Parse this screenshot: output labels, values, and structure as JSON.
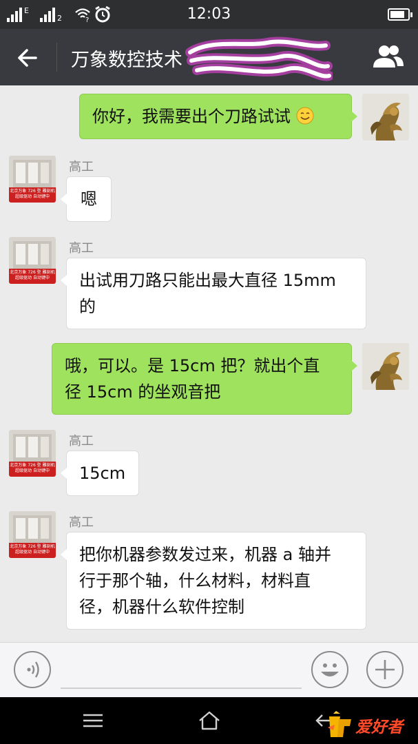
{
  "status_bar": {
    "time": "12:03",
    "network_tags": [
      "E",
      "2"
    ],
    "battery_level": 0.85
  },
  "header": {
    "title": "万象数控技术"
  },
  "messages": [
    {
      "direction": "outgoing",
      "lines": [
        "你好，我需要出个刀路试试"
      ],
      "emoji": "smile-emoji"
    },
    {
      "direction": "incoming",
      "sender": "高工",
      "lines": [
        "嗯"
      ]
    },
    {
      "direction": "incoming",
      "sender": "高工",
      "lines": [
        "出试用刀路只能出最大直径 15mm",
        "的"
      ]
    },
    {
      "direction": "outgoing",
      "lines": [
        "哦，可以。是 15cm 把？就出个直",
        "径 15cm 的坐观音把"
      ]
    },
    {
      "direction": "incoming",
      "sender": "高工",
      "lines": [
        "15cm"
      ]
    },
    {
      "direction": "incoming",
      "sender": "高工",
      "lines": [
        "把你机器参数发过来，机器 a 轴并",
        "行于那个轴，什么材料，材料直",
        "径，机器什么软件控制"
      ]
    }
  ],
  "avatar_caption": {
    "line1": "北京万象 726 型 雕刻机",
    "line2": "超级驱动 自动键中"
  },
  "input_bar": {
    "voice_icon": "voice-icon",
    "emoji_icon": "smiley-icon",
    "more_icon": "plus-icon"
  },
  "watermark": {
    "text": "爱好者"
  },
  "colors": {
    "outgoing_bubble": "#9fe25d",
    "incoming_bubble": "#ffffff",
    "title_bar": "#393a3f",
    "chat_background": "#ebebeb",
    "scribble": "#ff44ee"
  }
}
